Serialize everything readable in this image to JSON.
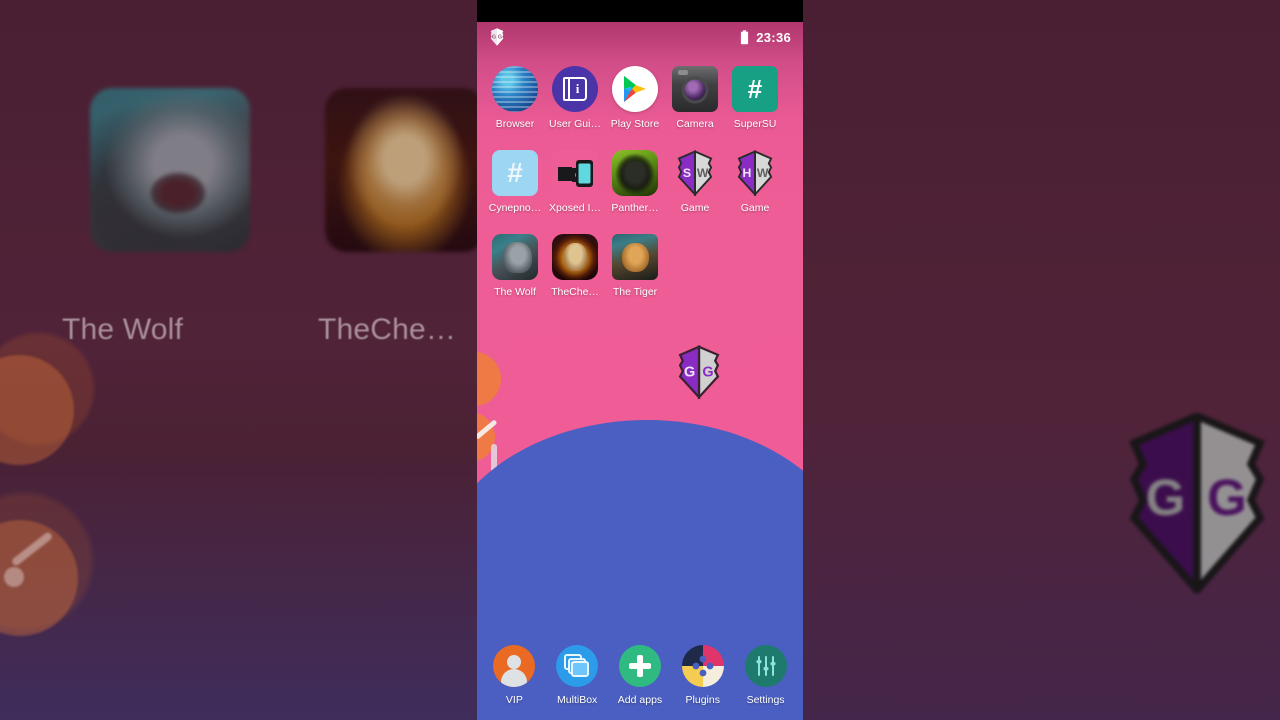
{
  "theme": {
    "wallpaper_pink": "#ef5d96",
    "wallpaper_blue": "#4a5fc1",
    "wallpaper_teal": "#49a3b8",
    "backdrop_maroon": "#4d2134",
    "accent_orange": "#f07a45"
  },
  "status_bar": {
    "notification_icon": "gameguardian-icon",
    "battery_icon": "battery-full-icon",
    "time": "23:36"
  },
  "app_grid": {
    "rows": [
      [
        {
          "label": "Browser",
          "icon": "browser-globe-icon"
        },
        {
          "label": "User Gui…",
          "icon": "user-guide-book-icon"
        },
        {
          "label": "Play Store",
          "icon": "play-store-icon"
        },
        {
          "label": "Camera",
          "icon": "camera-icon"
        },
        {
          "label": "SuperSU",
          "icon": "supersu-hash-icon"
        }
      ],
      [
        {
          "label": "Cynepno…",
          "icon": "superuser-hash-icon"
        },
        {
          "label": "Xposed I…",
          "icon": "xposed-installer-icon"
        },
        {
          "label": "Panther…",
          "icon": "panther-game-icon"
        },
        {
          "label": "Game",
          "icon": "gameguardian-sw-shield-icon"
        },
        {
          "label": "Game",
          "icon": "gameguardian-hw-shield-icon"
        }
      ],
      [
        {
          "label": "The Wolf",
          "icon": "the-wolf-game-icon"
        },
        {
          "label": "TheChe…",
          "icon": "the-cheetah-game-icon"
        },
        {
          "label": "The Tiger",
          "icon": "the-tiger-game-icon"
        }
      ]
    ],
    "shield_sw_text": "SW",
    "shield_hw_text": "HW"
  },
  "floating_widget": {
    "name": "GameGuardian floating icon",
    "text": "GG"
  },
  "dock": {
    "items": [
      {
        "label": "VIP",
        "icon": "vip-avatar-icon"
      },
      {
        "label": "MultiBox",
        "icon": "multibox-layers-icon"
      },
      {
        "label": "Add apps",
        "icon": "add-apps-plus-icon"
      },
      {
        "label": "Plugins",
        "icon": "plugins-puzzle-icon"
      },
      {
        "label": "Settings",
        "icon": "settings-sliders-icon"
      }
    ]
  },
  "backdrop": {
    "left_label_1": "The Wolf",
    "left_label_2": "TheChe…",
    "right_logo_text": "GG"
  }
}
